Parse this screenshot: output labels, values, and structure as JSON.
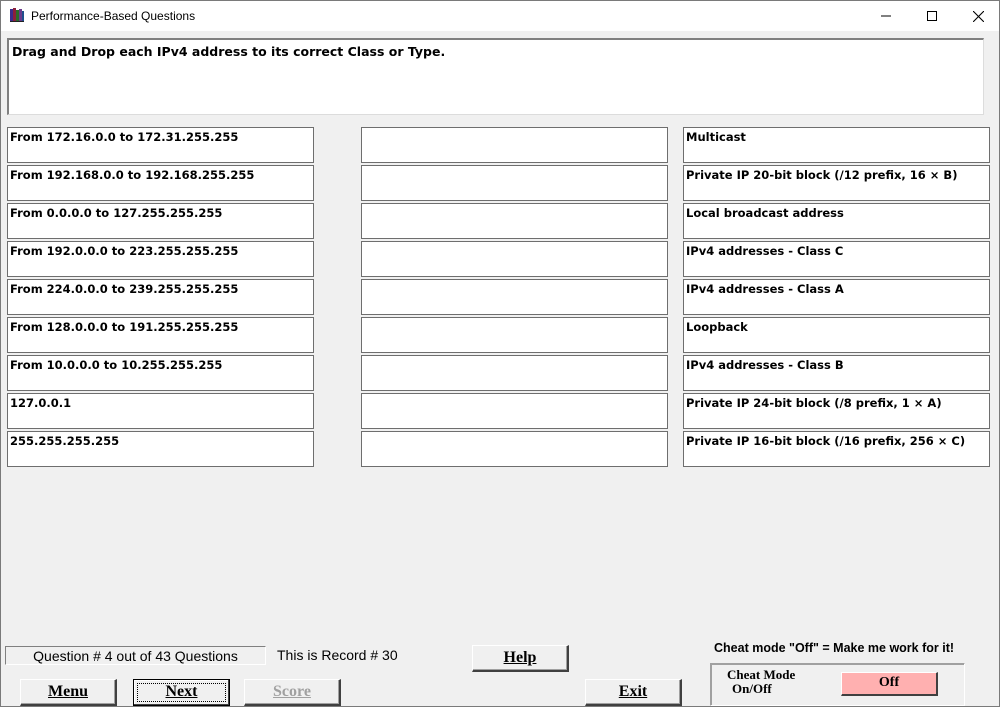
{
  "window": {
    "title": "Performance-Based Questions"
  },
  "instruction": "Drag and Drop each IPv4 address to its correct Class or Type.",
  "left_items": [
    "From 172.16.0.0 to 172.31.255.255",
    "From 192.168.0.0 to 192.168.255.255",
    "From 0.0.0.0 to 127.255.255.255",
    "From 192.0.0.0 to 223.255.255.255",
    "From 224.0.0.0 to 239.255.255.255",
    "From 128.0.0.0 to 191.255.255.255",
    "From 10.0.0.0 to 10.255.255.255",
    "127.0.0.1",
    "255.255.255.255"
  ],
  "middle_items": [
    "",
    "",
    "",
    "",
    "",
    "",
    "",
    "",
    ""
  ],
  "right_items": [
    "Multicast",
    "Private IP 20-bit block (/12 prefix, 16 × B)",
    "Local broadcast address",
    "IPv4 addresses - Class C",
    "IPv4 addresses - Class A",
    "Loopback",
    "IPv4 addresses - Class B",
    "Private IP 24-bit block (/8 prefix, 1 × A)",
    "Private IP 16-bit block (/16 prefix, 256 × C)"
  ],
  "footer": {
    "question_counter": "Question # 4 out of 43 Questions",
    "record": "This is Record # 30",
    "help_label": "Help",
    "menu_label": "Menu",
    "next_label": "Next",
    "score_label": "Score",
    "exit_label": "Exit",
    "cheat_status": "Cheat mode \"Off\" = Make me work for it!",
    "cheat_label_line1": "Cheat Mode",
    "cheat_label_line2": "On/Off",
    "cheat_toggle": "Off",
    "cheat_toggle_color": "#ffb0b0"
  }
}
